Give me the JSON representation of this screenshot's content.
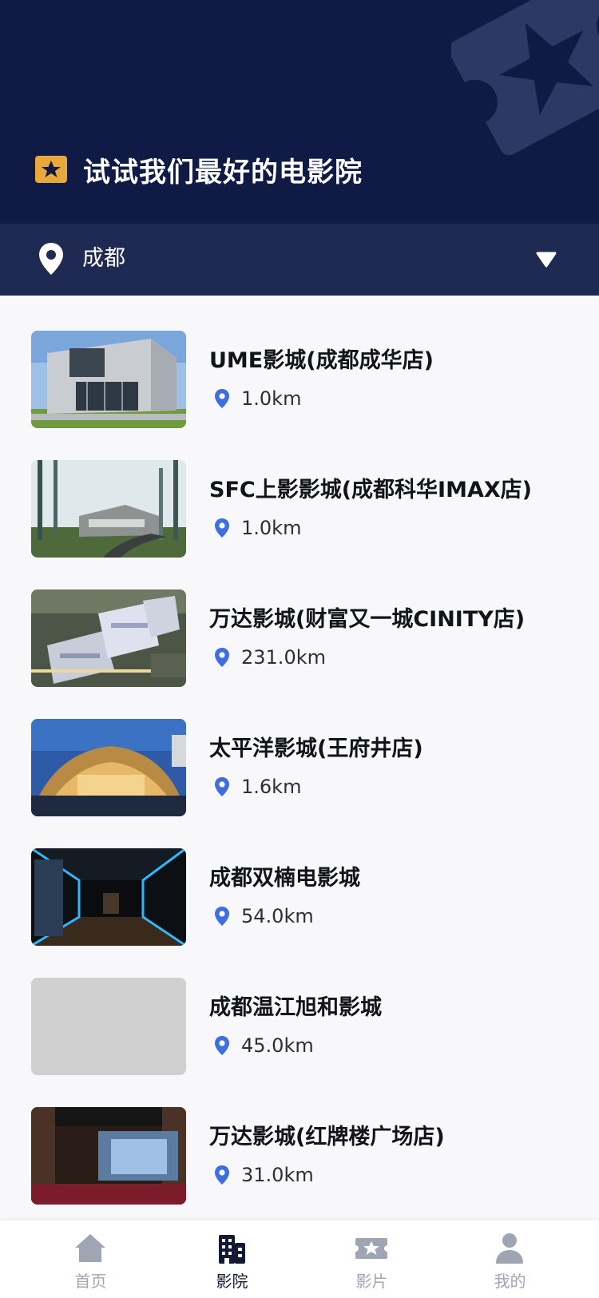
{
  "header": {
    "title": "试试我们最好的电影院"
  },
  "city_bar": {
    "city": "成都"
  },
  "cinemas": [
    {
      "name": "UME影城(成都成华店)",
      "distance": "1.0km",
      "image": "modern-building"
    },
    {
      "name": "SFC上影影城(成都科华IMAX店)",
      "distance": "1.0km",
      "image": "forest-building"
    },
    {
      "name": "万达影城(财富又一城CINITY店)",
      "distance": "231.0km",
      "image": "aerial-complex"
    },
    {
      "name": "太平洋影城(王府井店)",
      "distance": "1.6km",
      "image": "dusk-roof-building"
    },
    {
      "name": "成都双楠电影城",
      "distance": "54.0km",
      "image": "neon-corridor"
    },
    {
      "name": "成都温江旭和影城",
      "distance": "45.0km",
      "image": "placeholder"
    },
    {
      "name": "万达影城(红牌楼广场店)",
      "distance": "31.0km",
      "image": "theater-hall"
    }
  ],
  "tabs": [
    {
      "label": "首页",
      "icon": "home-icon",
      "active": false
    },
    {
      "label": "影院",
      "icon": "building-icon",
      "active": true
    },
    {
      "label": "影片",
      "icon": "ticket-star-icon",
      "active": false
    },
    {
      "label": "我的",
      "icon": "user-icon",
      "active": false
    }
  ],
  "colors": {
    "header_bg": "#0f1b45",
    "city_bar_bg": "#1e2a52",
    "badge_gold": "#e8a93a",
    "pin_blue": "#3d6fe3",
    "tab_active": "#141a33",
    "tab_inactive": "#a0a5b4"
  }
}
